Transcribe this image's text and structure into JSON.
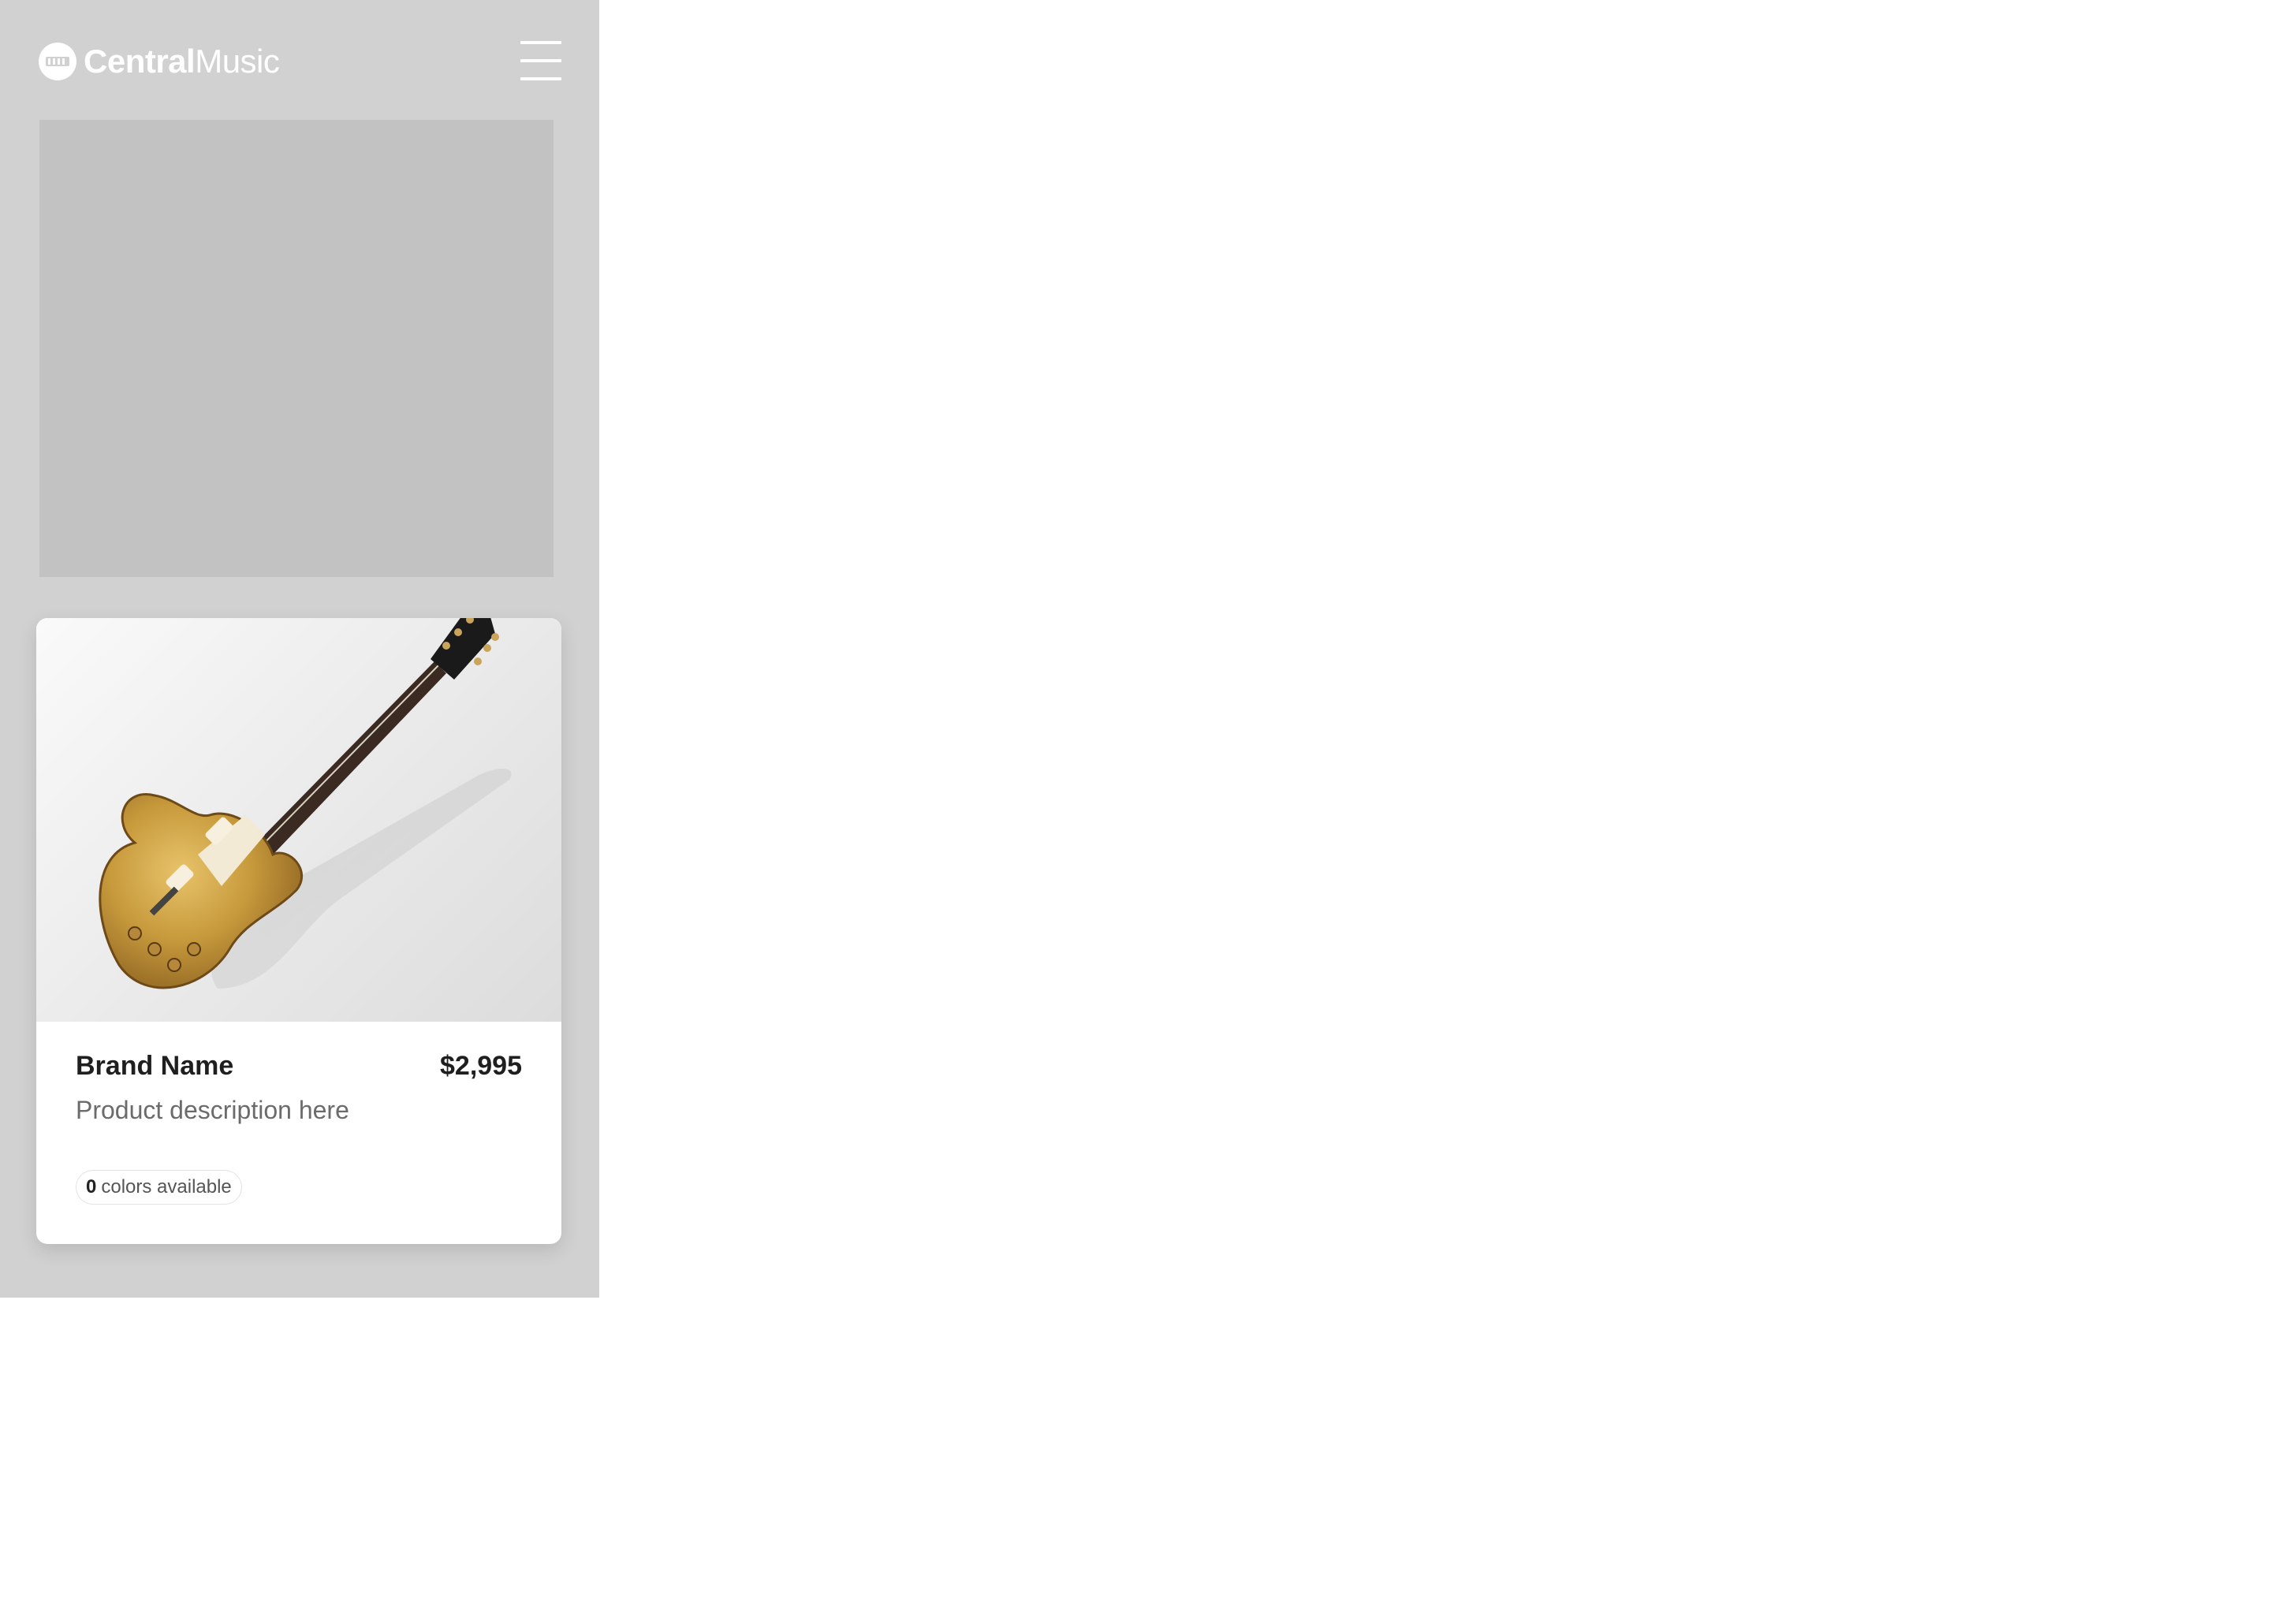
{
  "header": {
    "logo": {
      "icon": "guitar-pick-logo-icon",
      "brand_bold": "Central",
      "brand_light": "Music"
    },
    "menu_icon": "hamburger-menu-icon"
  },
  "product": {
    "image_alt": "gold-top-electric-guitar",
    "brand": "Brand Name",
    "price": "$2,995",
    "description": "Product description here",
    "colors_count": "0",
    "colors_label": "colors available"
  },
  "colors": {
    "panel_bg": "#d1d1d1",
    "placeholder_bg": "#c2c2c2",
    "card_bg": "#ffffff",
    "text_primary": "#1f1f1f",
    "text_secondary": "#6b6b6b"
  }
}
